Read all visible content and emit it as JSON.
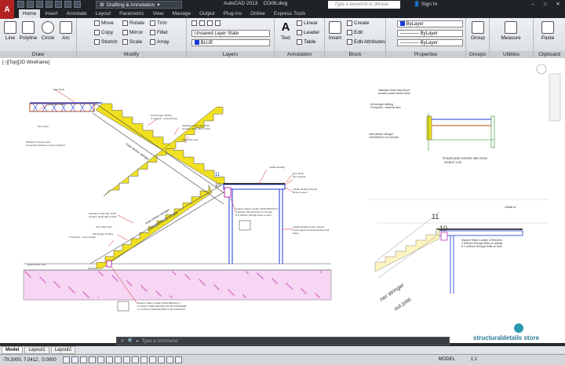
{
  "app": {
    "title": "AutoCAD 2013",
    "file": "CO06.dwg",
    "workspace": "Drafting & Annotation",
    "search_placeholder": "Type a keyword or phrase",
    "signin": "Sign In",
    "logo": "A"
  },
  "tabs": [
    "Home",
    "Insert",
    "Annotate",
    "Layout",
    "Parametric",
    "View",
    "Manage",
    "Output",
    "Plug-ins",
    "Online",
    "Express Tools"
  ],
  "ribbon": {
    "draw": {
      "label": "Draw",
      "line": "Line",
      "polyline": "Polyline",
      "circle": "Circle",
      "arc": "Arc"
    },
    "modify": {
      "label": "Modify",
      "move": "Move",
      "rotate": "Rotate",
      "trim": "Trim",
      "copy": "Copy",
      "mirror": "Mirror",
      "fillet": "Fillet",
      "stretch": "Stretch",
      "scale": "Scale",
      "array": "Array"
    },
    "layers": {
      "label": "Layers",
      "state": "Unsaved Layer State",
      "current": "BLUE"
    },
    "annotation": {
      "label": "Annotation",
      "text": "Text",
      "linear": "Linear",
      "leader": "Leader",
      "table": "Table"
    },
    "block": {
      "label": "Block",
      "insert": "Insert",
      "create": "Create",
      "edit": "Edit",
      "edit_attr": "Edit Attributes"
    },
    "properties": {
      "label": "Properties",
      "color": "ByLayer",
      "linetype": "ByLayer",
      "lineweight": "ByLayer"
    },
    "groups": {
      "label": "Groups",
      "group": "Group"
    },
    "utilities": {
      "label": "Utilities",
      "measure": "Measure"
    },
    "clipboard": {
      "label": "Clipboard",
      "paste": "Paste"
    }
  },
  "viewport_label": "[−][Top][2D Wireframe]",
  "drawing": {
    "left": {
      "fix_labels": [
        "floor finish",
        "upper floor level",
        "floor joists",
        "90x50mm trimmer joist",
        "connection between 2 steel stringers",
        "Full stringer skirting",
        "If required - external face",
        "staircase tread step finish",
        "wooden plank 40mm thick",
        "6mm thick riser",
        "middle landing",
        "floor finish",
        "floor boards",
        "middle landing framing",
        "timber beams",
        "Support Steel L-angle L200x100x10mm",
        "2 ø16mm through bolts on stringer",
        "& 2 ø16mm through bolts on floor",
        "staircase tread step finish",
        "wooden plank 40mm thick",
        "6mm thick riser",
        "full stringer skirting",
        "if required - external face",
        "middle landing timber column",
        "posts support at load bearing wall",
        "frame",
        "ground floor level",
        "Support Steel L-angle L200x100x10mm",
        "2 ø16mm THROUGH BOLTS ON STRINGER",
        "& 2 ø16mm ANCHOR BOLTS ON GROUND"
      ],
      "steps": [
        "20",
        "11",
        "10"
      ],
      "stringer_text": [
        "main timber stringer",
        "100x300mm cut out joist"
      ]
    },
    "right": {
      "labels": [
        "staircase tread step finish",
        "wooden plank 40mm thick",
        "full stringer skirting",
        "if required - external face",
        "main timber stringer",
        "100x300mm cut out joist",
        "STAIRCASE CROSS SECTION",
        "SCALE 1:10",
        "middle la",
        "Support Steel L-angle L200x100x",
        "2 ø16mm through bolts on stringe",
        "& 2 ø16mm through bolts on floor"
      ],
      "steps": [
        "11",
        "10"
      ],
      "stringer_text": [
        "ner stringer",
        "out joist"
      ]
    }
  },
  "watermark": "structuraldetails store",
  "command_placeholder": "Type a command",
  "layout_tabs": [
    "Model",
    "Layout1",
    "Layout2"
  ],
  "status": {
    "coords": "-79.3000, 7.0412 , 0.0000",
    "model": "MODEL",
    "scale": "1:1"
  }
}
